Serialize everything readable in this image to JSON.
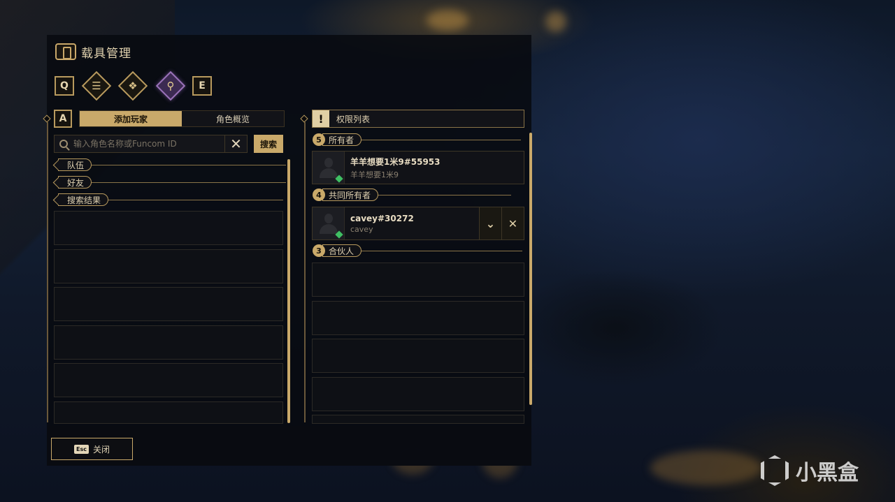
{
  "header": {
    "title": "载具管理",
    "key_left": "Q",
    "key_right": "E",
    "tab_icons": [
      "list-icon",
      "cubes-icon",
      "key-icon"
    ],
    "active_tab_icon": "key-icon"
  },
  "left_panel": {
    "key": "A",
    "tabs": [
      {
        "label": "添加玩家",
        "active": true
      },
      {
        "label": "角色概览",
        "active": false
      }
    ],
    "search": {
      "placeholder": "输入角色名称或Funcom ID",
      "value": "",
      "button_label": "搜索"
    },
    "sections": [
      "队伍",
      "好友",
      "搜索结果"
    ]
  },
  "right_panel": {
    "header": "权限列表",
    "warning_symbol": "!",
    "groups": [
      {
        "count": "5",
        "label": "所有者",
        "members": [
          {
            "name": "羊羊想要1米9#55953",
            "sub": "羊羊想要1米9",
            "online": true
          }
        ]
      },
      {
        "count": "4",
        "label": "共同所有者",
        "members": [
          {
            "name": "cavey#30272",
            "sub": "cavey",
            "online": true
          }
        ]
      },
      {
        "count": "3",
        "label": "合伙人",
        "members": []
      }
    ]
  },
  "footer": {
    "esc_key": "Esc",
    "close_label": "关闭"
  },
  "watermark": {
    "text": "小黑盒"
  },
  "colors": {
    "accent_gold": "#c9a96a",
    "panel_bg": "#08090f",
    "active_tab_purple": "#3c2a52",
    "online_green": "#3fbf63"
  }
}
